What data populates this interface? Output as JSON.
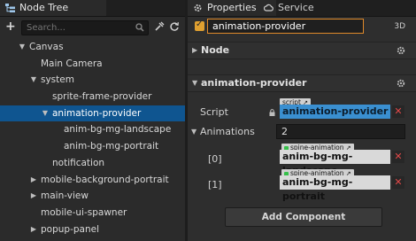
{
  "node_tree": {
    "tab_label": "Node Tree",
    "search_placeholder": "Search...",
    "nodes": [
      {
        "label": "Canvas",
        "depth": 0,
        "arrow": "▼"
      },
      {
        "label": "Main Camera",
        "depth": 1,
        "arrow": ""
      },
      {
        "label": "system",
        "depth": 1,
        "arrow": "▼"
      },
      {
        "label": "sprite-frame-provider",
        "depth": 2,
        "arrow": ""
      },
      {
        "label": "animation-provider",
        "depth": 2,
        "arrow": "▼",
        "selected": true
      },
      {
        "label": "anim-bg-mg-landscape",
        "depth": 3,
        "arrow": ""
      },
      {
        "label": "anim-bg-mg-portrait",
        "depth": 3,
        "arrow": ""
      },
      {
        "label": "notification",
        "depth": 2,
        "arrow": ""
      },
      {
        "label": "mobile-background-portrait",
        "depth": 1,
        "arrow": "▶"
      },
      {
        "label": "main-view",
        "depth": 1,
        "arrow": "▶"
      },
      {
        "label": "mobile-ui-spawner",
        "depth": 1,
        "arrow": ""
      },
      {
        "label": "popup-panel",
        "depth": 1,
        "arrow": "▶"
      }
    ]
  },
  "properties": {
    "tab_properties": "Properties",
    "tab_service": "Service",
    "node_name": "animation-provider",
    "mode_label": "3D",
    "section_node": "Node",
    "section_component": "animation-provider",
    "script_label": "Script",
    "script_tag": "script",
    "script_value": "animation-provider",
    "animations_label": "Animations",
    "animations_count": "2",
    "items": [
      {
        "index": "[0]",
        "tag": "spine-animation",
        "value": "anim-bg-mg-landscape"
      },
      {
        "index": "[1]",
        "tag": "spine-animation",
        "value": "anim-bg-mg-portrait"
      }
    ],
    "add_component": "Add Component"
  },
  "colors": {
    "selection": "#0f5590",
    "accent_orange": "#e08a2a",
    "script_blue": "#3a8fd0",
    "remove_red": "#e04848"
  }
}
